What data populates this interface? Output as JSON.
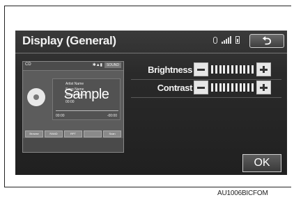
{
  "screen": {
    "title": "Display (General)",
    "back_label": "⮌",
    "ok_label": "OK"
  },
  "status_icons": [
    "bluetooth-icon",
    "signal-icon",
    "battery-icon"
  ],
  "settings": [
    {
      "label": "Brightness",
      "level": 0.5
    },
    {
      "label": "Contrast",
      "level": 0.5
    }
  ],
  "preview": {
    "source": "CD",
    "sound_label": "SOUND",
    "artist": "Artist Name",
    "song": "Song Name",
    "album": "Album Name",
    "track_time": "00:00",
    "elapsed": "00:00",
    "remaining": "-00:00",
    "sample_text": "Sample",
    "buttons": [
      "Browse",
      "RAND",
      "RPT",
      "",
      "Scan"
    ]
  },
  "caption": "AU1006BICFOM"
}
